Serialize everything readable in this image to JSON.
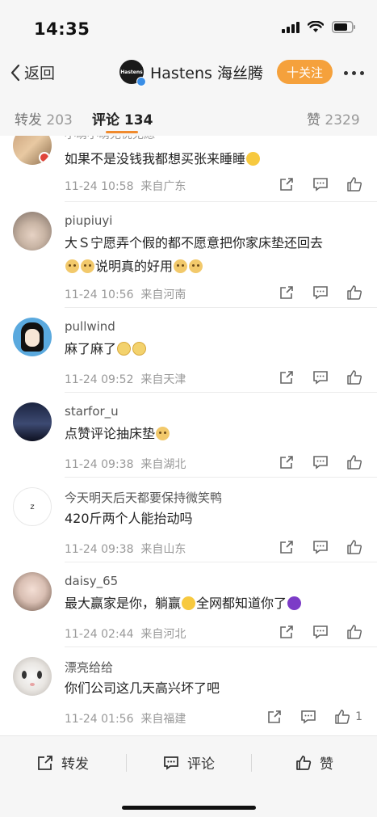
{
  "status": {
    "time": "14:35"
  },
  "nav": {
    "back_label": "返回",
    "logo_text": "Hastens",
    "title": "Hastens 海丝腾",
    "follow_label": "十关注"
  },
  "tabs": [
    {
      "label": "转发",
      "count": "203"
    },
    {
      "label": "评论",
      "count": "134"
    },
    {
      "label": "赞",
      "count": "2329"
    }
  ],
  "comments": [
    {
      "username": "",
      "partial_name": "小萌小萌无忧无虑",
      "text": "如果不是没钱我都想买张来睡睡",
      "emojis": [
        "laugh"
      ],
      "time": "11-24 10:58",
      "location": "来自广东",
      "likes": ""
    },
    {
      "username": "piupiuyi",
      "text_line1": "大Ｓ宁愿弄个假的都不愿意把你家床垫还回去",
      "text_line2": "说明真的好用",
      "time": "11-24 10:56",
      "location": "来自河南",
      "likes": ""
    },
    {
      "username": "pullwind",
      "text": "麻了麻了",
      "time": "11-24 09:52",
      "location": "来自天津",
      "likes": ""
    },
    {
      "username": "starfor_u",
      "text": "点赞评论抽床垫",
      "time": "11-24 09:38",
      "location": "来自湖北",
      "likes": ""
    },
    {
      "username": "今天明天后天都要保持微笑鸭",
      "text": "420斤两个人能抬动吗",
      "time": "11-24 09:38",
      "location": "来自山东",
      "likes": ""
    },
    {
      "username": "daisy_65",
      "text_a": "最大赢家是你，躺赢",
      "text_b": "全网都知道你了",
      "time": "11-24 02:44",
      "location": "来自河北",
      "likes": ""
    },
    {
      "username": "漂亮给给",
      "text": "你们公司这几天高兴坏了吧",
      "time": "11-24 01:56",
      "location": "来自福建",
      "likes": "1"
    }
  ],
  "bottom_bar": {
    "repost_label": "转发",
    "comment_label": "评论",
    "like_label": "赞"
  },
  "colors": {
    "accent": "#f5a13c",
    "tab_underline": "#f08a2d",
    "verified": "#3a8ee6"
  }
}
